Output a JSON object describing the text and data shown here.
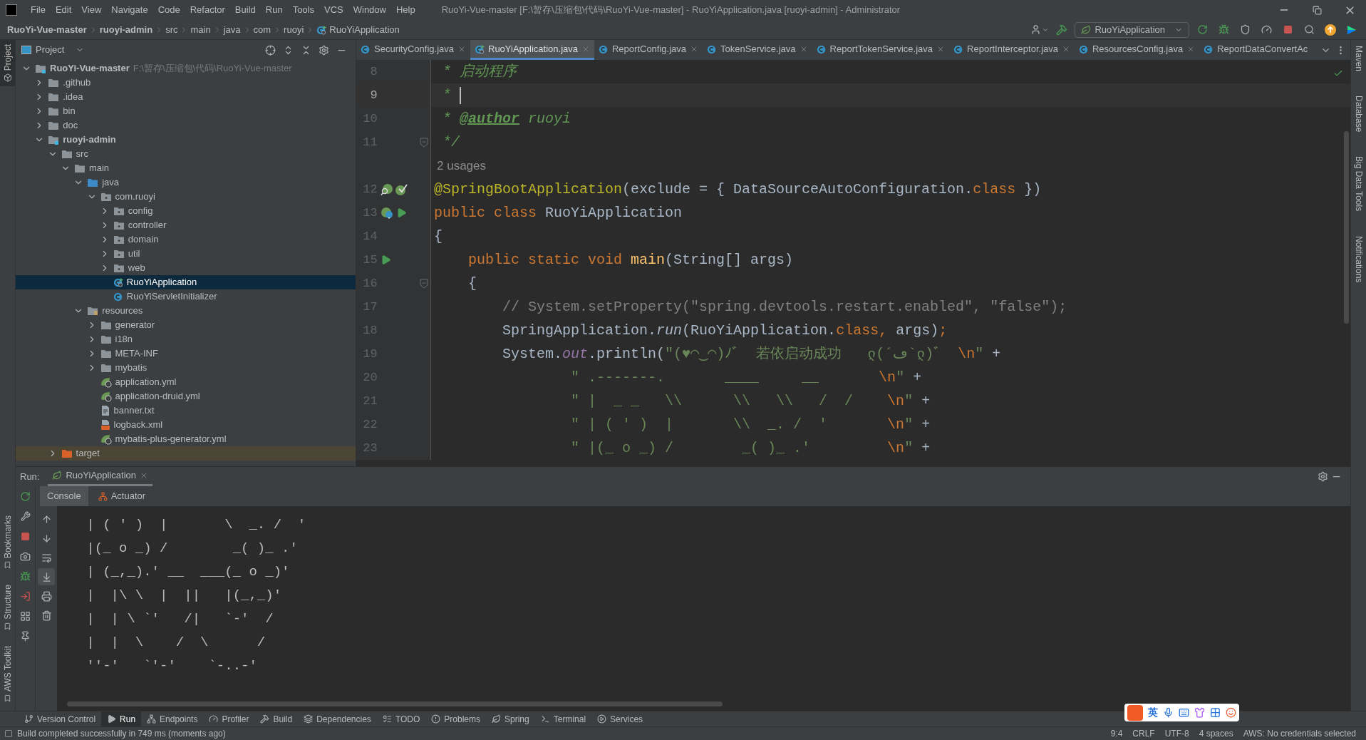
{
  "window": {
    "title": "RuoYi-Vue-master [F:\\暂存\\压缩包\\代码\\RuoYi-Vue-master] - RuoYiApplication.java [ruoyi-admin] - Administrator"
  },
  "menu": [
    "File",
    "Edit",
    "View",
    "Navigate",
    "Code",
    "Refactor",
    "Build",
    "Run",
    "Tools",
    "VCS",
    "Window",
    "Help"
  ],
  "breadcrumbs": [
    {
      "label": "RuoYi-Vue-master",
      "bold": true
    },
    {
      "label": "ruoyi-admin",
      "bold": true
    },
    {
      "label": "src",
      "bold": false
    },
    {
      "label": "main",
      "bold": false
    },
    {
      "label": "java",
      "bold": false
    },
    {
      "label": "com",
      "bold": false
    },
    {
      "label": "ruoyi",
      "bold": false
    },
    {
      "label": "RuoYiApplication",
      "bold": false,
      "kind": "class-run"
    }
  ],
  "run_config": {
    "label": "RuoYiApplication"
  },
  "left_strip": {
    "top": [
      {
        "label": "Project",
        "selected": true
      }
    ],
    "bottom": [
      {
        "label": "Bookmarks",
        "selected": false
      },
      {
        "label": "Structure",
        "selected": false
      },
      {
        "label": "AWS Toolkit",
        "selected": false
      }
    ]
  },
  "right_strip": [
    "Maven",
    "Database",
    "Big Data Tools",
    "Notifications"
  ],
  "project_panel": {
    "title": "Project",
    "tree": [
      {
        "label": "RuoYi-Vue-master",
        "hint": "F:\\暂存\\压缩包\\代码\\RuoYi-Vue-master",
        "bold": true,
        "kind": "module",
        "expanded": true,
        "selected": false,
        "children": [
          {
            "label": ".github",
            "kind": "folder",
            "expanded": false,
            "selected": false
          },
          {
            "label": ".idea",
            "kind": "folder",
            "expanded": false,
            "selected": false
          },
          {
            "label": "bin",
            "kind": "folder",
            "expanded": false,
            "selected": false
          },
          {
            "label": "doc",
            "kind": "folder",
            "expanded": false,
            "selected": false
          },
          {
            "label": "ruoyi-admin",
            "bold": true,
            "kind": "module",
            "expanded": true,
            "selected": false,
            "children": [
              {
                "label": "src",
                "kind": "folder",
                "expanded": true,
                "selected": false,
                "children": [
                  {
                    "label": "main",
                    "kind": "folder",
                    "expanded": true,
                    "selected": false,
                    "children": [
                      {
                        "label": "java",
                        "kind": "source",
                        "expanded": true,
                        "selected": false,
                        "children": [
                          {
                            "label": "com.ruoyi",
                            "kind": "package",
                            "expanded": true,
                            "selected": false,
                            "children": [
                              {
                                "label": "config",
                                "kind": "package",
                                "expanded": false,
                                "selected": false
                              },
                              {
                                "label": "controller",
                                "kind": "package",
                                "expanded": false,
                                "selected": false
                              },
                              {
                                "label": "domain",
                                "kind": "package",
                                "expanded": false,
                                "selected": false
                              },
                              {
                                "label": "util",
                                "kind": "package",
                                "expanded": false,
                                "selected": false
                              },
                              {
                                "label": "web",
                                "kind": "package",
                                "expanded": false,
                                "selected": false
                              },
                              {
                                "label": "RuoYiApplication",
                                "kind": "class-run",
                                "selected": true
                              },
                              {
                                "label": "RuoYiServletInitializer",
                                "kind": "class",
                                "selected": false
                              }
                            ]
                          }
                        ]
                      },
                      {
                        "label": "resources",
                        "kind": "resources",
                        "expanded": true,
                        "selected": false,
                        "children": [
                          {
                            "label": "generator",
                            "kind": "folder",
                            "expanded": false,
                            "selected": false
                          },
                          {
                            "label": "i18n",
                            "kind": "folder",
                            "expanded": false,
                            "selected": false
                          },
                          {
                            "label": "META-INF",
                            "kind": "folder",
                            "expanded": false,
                            "selected": false
                          },
                          {
                            "label": "mybatis",
                            "kind": "folder",
                            "expanded": false,
                            "selected": false
                          },
                          {
                            "label": "application.yml",
                            "kind": "spring-yml",
                            "selected": false
                          },
                          {
                            "label": "application-druid.yml",
                            "kind": "spring-yml",
                            "selected": false
                          },
                          {
                            "label": "banner.txt",
                            "kind": "text",
                            "selected": false
                          },
                          {
                            "label": "logback.xml",
                            "kind": "xml",
                            "selected": false
                          },
                          {
                            "label": "mybatis-plus-generator.yml",
                            "kind": "spring-yml",
                            "selected": false
                          }
                        ]
                      }
                    ]
                  }
                ]
              },
              {
                "label": "target",
                "kind": "excluded",
                "expanded": false,
                "selected": false
              }
            ]
          }
        ]
      }
    ]
  },
  "editor": {
    "tabs": [
      {
        "label": "SecurityConfig.java",
        "selected": false,
        "closable": true
      },
      {
        "label": "RuoYiApplication.java",
        "selected": true,
        "closable": true,
        "kind": "class-run"
      },
      {
        "label": "ReportConfig.java",
        "selected": false,
        "closable": true
      },
      {
        "label": "TokenService.java",
        "selected": false,
        "closable": true
      },
      {
        "label": "ReportTokenService.java",
        "selected": false,
        "closable": true
      },
      {
        "label": "ReportInterceptor.java",
        "selected": false,
        "closable": true
      },
      {
        "label": "ResourcesConfig.java",
        "selected": false,
        "closable": true
      },
      {
        "label": "ReportDataConvertAc",
        "selected": false,
        "closable": false
      }
    ],
    "lines": [
      {
        "number": "8",
        "current": false,
        "tokens": [
          {
            "kind": "doc",
            "text": " * 启动程序"
          }
        ]
      },
      {
        "number": "9",
        "current": true,
        "caret": true,
        "tokens": [
          {
            "kind": "doc",
            "text": " * "
          }
        ]
      },
      {
        "number": "10",
        "current": false,
        "tokens": [
          {
            "kind": "doc",
            "text": " * "
          },
          {
            "kind": "tag",
            "text": "@author"
          },
          {
            "kind": "doc",
            "text": " ruoyi"
          }
        ]
      },
      {
        "number": "11",
        "current": false,
        "fold": true,
        "tokens": [
          {
            "kind": "doc",
            "text": " */"
          }
        ]
      },
      {
        "kind": "inlay",
        "text": "2 usages"
      },
      {
        "number": "12",
        "current": false,
        "bean": true,
        "check": true,
        "tokens": [
          {
            "kind": "annotation",
            "text": "@SpringBootApplication"
          },
          {
            "kind": "plain",
            "text": "(exclude = { DataSourceAutoConfiguration."
          },
          {
            "kind": "keyword",
            "text": "class"
          },
          {
            "kind": "plain",
            "text": " })"
          }
        ]
      },
      {
        "number": "13",
        "current": false,
        "spring_class": true,
        "run": true,
        "tokens": [
          {
            "kind": "keyword",
            "text": "public class "
          },
          {
            "kind": "plain",
            "text": "RuoYiApplication"
          }
        ]
      },
      {
        "number": "14",
        "current": false,
        "tokens": [
          {
            "kind": "plain",
            "text": "{"
          }
        ]
      },
      {
        "number": "15",
        "current": false,
        "run": true,
        "tokens": [
          {
            "kind": "keyword",
            "text": "    public static void "
          },
          {
            "kind": "method",
            "text": "main"
          },
          {
            "kind": "plain",
            "text": "(String[] args)"
          }
        ]
      },
      {
        "number": "16",
        "current": false,
        "fold": true,
        "tokens": [
          {
            "kind": "plain",
            "text": "    {"
          }
        ]
      },
      {
        "number": "17",
        "current": false,
        "tokens": [
          {
            "kind": "comment",
            "text": "        // System.setProperty(\"spring.devtools.restart.enabled\", \"false\");"
          }
        ]
      },
      {
        "number": "18",
        "current": false,
        "tokens": [
          {
            "kind": "plain",
            "text": "        SpringApplication."
          },
          {
            "kind": "italic",
            "text": "run"
          },
          {
            "kind": "plain",
            "text": "(RuoYiApplication."
          },
          {
            "kind": "keyword",
            "text": "class, "
          },
          {
            "kind": "plain",
            "text": "args)"
          },
          {
            "kind": "keyword",
            "text": ";"
          }
        ]
      },
      {
        "number": "19",
        "current": false,
        "tokens": [
          {
            "kind": "plain",
            "text": "        System."
          },
          {
            "kind": "static",
            "text": "out"
          },
          {
            "kind": "plain",
            "text": ".println("
          },
          {
            "kind": "string",
            "text": "\"(♥◠‿◠)ﾉﾞ  若依启动成功   ლ(´ڡ`ლ)ﾞ  "
          },
          {
            "kind": "escape",
            "text": "\\n"
          },
          {
            "kind": "string",
            "text": "\""
          },
          {
            "kind": "plain",
            "text": " +"
          }
        ]
      },
      {
        "number": "20",
        "current": false,
        "tokens": [
          {
            "kind": "string",
            "text": "                \" .-------.       ____     __       "
          },
          {
            "kind": "escape",
            "text": "\\n"
          },
          {
            "kind": "string",
            "text": "\""
          },
          {
            "kind": "plain",
            "text": " +"
          }
        ]
      },
      {
        "number": "21",
        "current": false,
        "tokens": [
          {
            "kind": "string",
            "text": "                \" |  _ _   \\\\      \\\\   \\\\   /  /    "
          },
          {
            "kind": "escape",
            "text": "\\n"
          },
          {
            "kind": "string",
            "text": "\""
          },
          {
            "kind": "plain",
            "text": " +"
          }
        ]
      },
      {
        "number": "22",
        "current": false,
        "tokens": [
          {
            "kind": "string",
            "text": "                \" | ( ' )  |       \\\\  _. /  '       "
          },
          {
            "kind": "escape",
            "text": "\\n"
          },
          {
            "kind": "string",
            "text": "\""
          },
          {
            "kind": "plain",
            "text": " +"
          }
        ]
      },
      {
        "number": "23",
        "current": false,
        "tokens": [
          {
            "kind": "string",
            "text": "                \" |(_ o _) /        _( )_ .'         "
          },
          {
            "kind": "escape",
            "text": "\\n"
          },
          {
            "kind": "string",
            "text": "\""
          },
          {
            "kind": "plain",
            "text": " +"
          }
        ]
      }
    ]
  },
  "run_panel": {
    "label": "Run:",
    "tab": {
      "label": "RuoYiApplication"
    },
    "subtabs": [
      {
        "label": "Console",
        "selected": true
      },
      {
        "label": "Actuator",
        "selected": false
      }
    ],
    "console": [
      " | ( ' )  |       \\  _. /  '",
      " |(_ o _) /        _( )_ .'",
      " | (_,_).' __  ___(_ o _)'",
      " |  |\\ \\  |  ||   |(_,_)'",
      " |  | \\ `'   /|   `-'  /",
      " |  |  \\    /  \\      /",
      " ''-'   `'-'    `-..-'"
    ]
  },
  "tool_windows": [
    {
      "label": "Version Control",
      "kind": "vcs",
      "selected": false
    },
    {
      "label": "Run",
      "kind": "run",
      "selected": true
    },
    {
      "label": "Endpoints",
      "kind": "endpoints",
      "selected": false
    },
    {
      "label": "Profiler",
      "kind": "profiler",
      "selected": false
    },
    {
      "label": "Build",
      "kind": "build",
      "selected": false
    },
    {
      "label": "Dependencies",
      "kind": "dependencies",
      "selected": false
    },
    {
      "label": "TODO",
      "kind": "todo",
      "selected": false
    },
    {
      "label": "Problems",
      "kind": "problems",
      "selected": false
    },
    {
      "label": "Spring",
      "kind": "spring",
      "selected": false
    },
    {
      "label": "Terminal",
      "kind": "terminal",
      "selected": false
    },
    {
      "label": "Services",
      "kind": "services",
      "selected": false
    }
  ],
  "status_bar": {
    "message": "Build completed successfully in 749 ms (moments ago)",
    "items": [
      "9:4",
      "CRLF",
      "UTF-8",
      "4 spaces",
      "AWS: No credentials selected"
    ]
  },
  "ime_toolbar": {
    "mode": "英"
  }
}
